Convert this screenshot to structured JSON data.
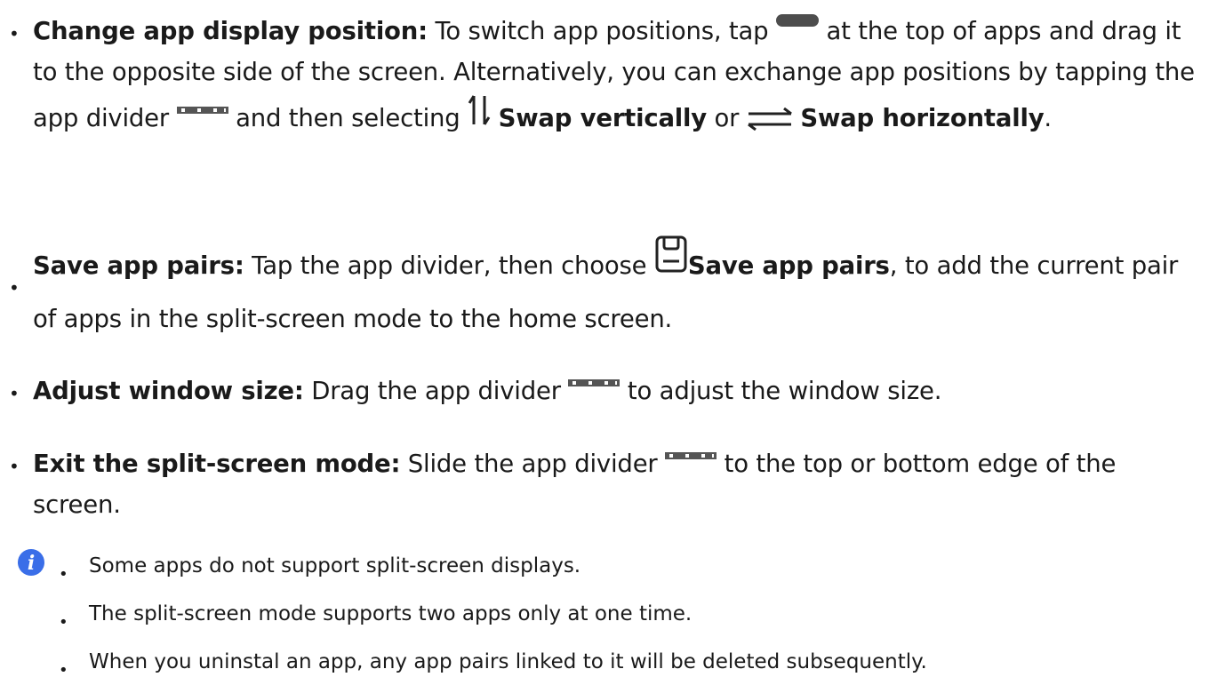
{
  "items": [
    {
      "title": "Change app display position:",
      "text1": " To switch app positions, tap ",
      "text2": " at the top of apps and drag it to the opposite side of the screen. Alternatively, you can exchange app positions by tapping the app divider ",
      "text3": " and then selecting ",
      "swap_vertically": "Swap vertically",
      "or": " or ",
      "swap_horizontally": "Swap horizontally",
      "end": "."
    },
    {
      "title": "Save app pairs:",
      "text1": " Tap the app divider, then choose ",
      "save_label": "Save app pairs",
      "text2": ", to add the current pair of apps in the split-screen mode to the home screen."
    },
    {
      "title": "Adjust window size:",
      "text1": " Drag the app divider ",
      "text2": " to adjust the window size."
    },
    {
      "title": "Exit the split-screen mode:",
      "text1": " Slide the app divider ",
      "text2": " to the top or bottom edge of the screen."
    }
  ],
  "notes": [
    "Some apps do not support split-screen displays.",
    "The split-screen mode supports two apps only at one time.",
    "When you uninstal an app, any app pairs linked to it will be deleted subsequently."
  ],
  "icons": {
    "handle": "handle-bar-icon",
    "divider": "app-divider-icon",
    "swap_vertical": "swap-vertical-icon",
    "swap_horizontal": "swap-horizontal-icon",
    "save": "save-icon",
    "info": "info-icon"
  },
  "colors": {
    "text": "#1a1a1a",
    "info": "#3a6ee8",
    "icon": "#333333"
  }
}
